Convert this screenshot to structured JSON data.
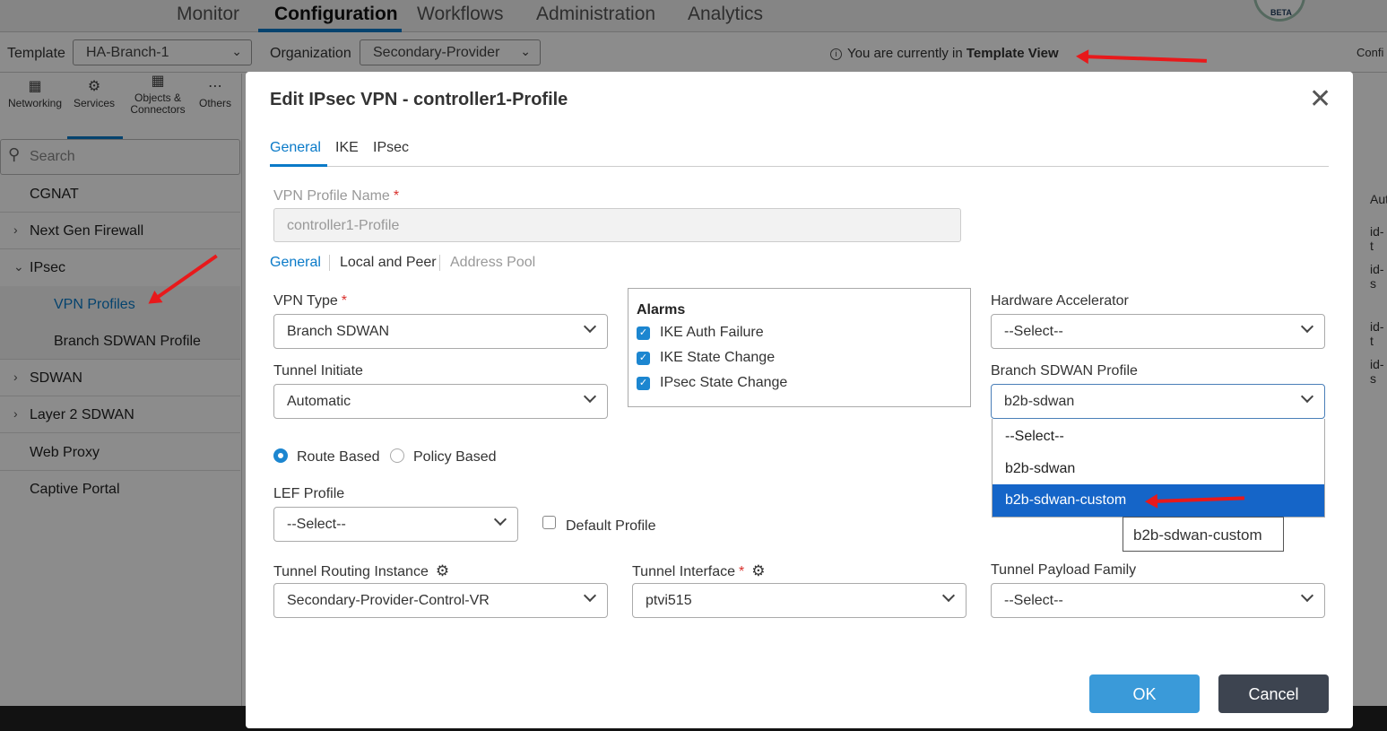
{
  "topnav": {
    "tabs": [
      "Monitor",
      "Configuration",
      "Workflows",
      "Administration",
      "Analytics"
    ],
    "active": "Configuration",
    "badge": "BETA"
  },
  "subbar": {
    "template_label": "Template",
    "template_value": "HA-Branch-1",
    "org_label": "Organization",
    "org_value": "Secondary-Provider",
    "info_prefix": "You are currently in",
    "info_view": "Template View",
    "right_text": "Confi"
  },
  "sidebar": {
    "tabs": [
      "Networking",
      "Services",
      "Objects &",
      "Connectors",
      "Others"
    ],
    "search_placeholder": "Search",
    "items": [
      "CGNAT",
      "Next Gen Firewall",
      "IPsec",
      "VPN Profiles",
      "Branch SDWAN Profile",
      "SDWAN",
      "Layer 2 SDWAN",
      "Web Proxy",
      "Captive Portal"
    ]
  },
  "right_panel": [
    "Aut",
    "id-t",
    "id-s",
    "id-t",
    "id-s"
  ],
  "modal": {
    "title": "Edit IPsec VPN - controller1-Profile",
    "tabs": [
      "General",
      "IKE",
      "IPsec"
    ],
    "profile_name_label": "VPN Profile Name",
    "profile_name_value": "controller1-Profile",
    "sub_tabs": [
      "General",
      "Local and Peer",
      "Address Pool"
    ],
    "vpn_type_label": "VPN Type",
    "vpn_type_value": "Branch SDWAN",
    "tunnel_initiate_label": "Tunnel Initiate",
    "tunnel_initiate_value": "Automatic",
    "alarms_title": "Alarms",
    "alarms": [
      "IKE Auth Failure",
      "IKE State Change",
      "IPsec State Change"
    ],
    "hw_accel_label": "Hardware Accelerator",
    "hw_accel_value": "--Select--",
    "branch_profile_label": "Branch SDWAN Profile",
    "branch_profile_value": "b2b-sdwan",
    "branch_profile_options": [
      "--Select--",
      "b2b-sdwan",
      "b2b-sdwan-custom"
    ],
    "tooltip": "b2b-sdwan-custom",
    "route_based": "Route Based",
    "policy_based": "Policy Based",
    "lef_label": "LEF Profile",
    "lef_value": "--Select--",
    "default_profile": "Default Profile",
    "routing_instance_label": "Tunnel Routing Instance",
    "routing_instance_value": "Secondary-Provider-Control-VR",
    "tunnel_interface_label": "Tunnel Interface",
    "tunnel_interface_value": "ptvi515",
    "payload_family_label": "Tunnel Payload Family",
    "payload_family_value": "--Select--",
    "ok": "OK",
    "cancel": "Cancel"
  },
  "colors": {
    "accent": "#0a7ac8",
    "selected_option": "#1565c8",
    "ok_button": "#3a9ad9",
    "cancel_button": "#3d4450",
    "annotation_arrow": "#e8191b"
  }
}
